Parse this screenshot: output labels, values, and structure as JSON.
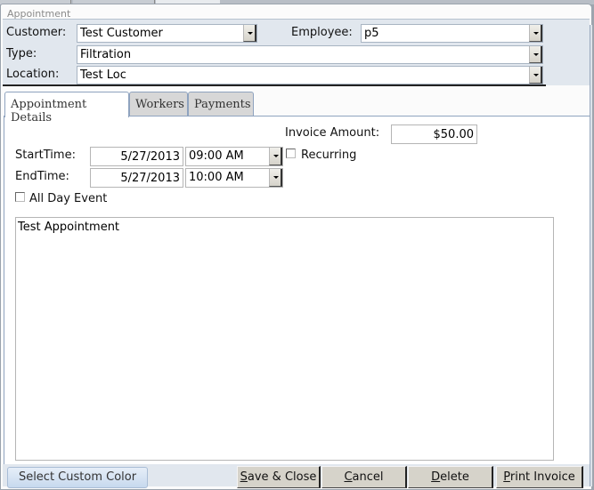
{
  "window": {
    "title": "Appointment"
  },
  "header": {
    "customer": {
      "label": "Customer:",
      "value": "Test Customer"
    },
    "employee": {
      "label": "Employee:",
      "value": "p5"
    },
    "type": {
      "label": "Type:",
      "value": "Filtration"
    },
    "location": {
      "label": "Location:",
      "value": "Test Loc"
    }
  },
  "tabs": [
    {
      "label": "Appointment Details",
      "active": true
    },
    {
      "label": "Workers",
      "active": false
    },
    {
      "label": "Payments",
      "active": false
    }
  ],
  "details": {
    "invoice_amount": {
      "label": "Invoice Amount:",
      "value": "$50.00"
    },
    "start": {
      "label": "StartTime:",
      "date": "5/27/2013",
      "time": "09:00 AM"
    },
    "end": {
      "label": "EndTime:",
      "date": "5/27/2013",
      "time": "10:00 AM"
    },
    "recurring": {
      "label": "Recurring",
      "checked": false
    },
    "all_day": {
      "label": "All Day Event",
      "checked": false
    },
    "notes": "Test Appointment"
  },
  "footer": {
    "select_color": "Select Custom Color",
    "save_close": {
      "mnemonic": "S",
      "rest": "ave & Close"
    },
    "cancel": {
      "mnemonic": "C",
      "rest": "ancel"
    },
    "delete": {
      "mnemonic": "D",
      "rest": "elete"
    },
    "print_invoice": {
      "mnemonic": "P",
      "rest": "rint Invoice"
    }
  }
}
